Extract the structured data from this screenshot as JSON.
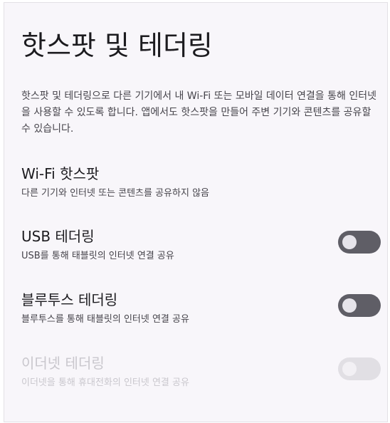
{
  "page": {
    "title": "핫스팟 및 테더링",
    "description": "핫스팟 및 테더링으로 다른 기기에서 내 Wi-Fi 또는 모바일 데이터 연결을 통해 인터넷을 사용할 수 있도록 합니다. 앱에서도 핫스팟을 만들어 주변 기기와 콘텐츠를 공유할 수 있습니다."
  },
  "items": [
    {
      "title": "Wi-Fi 핫스팟",
      "subtitle": "다른 기기와 인터넷 또는 콘텐츠를 공유하지 않음",
      "has_toggle": false
    },
    {
      "title": "USB 테더링",
      "subtitle": "USB를 통해 태블릿의 인터넷 연결 공유",
      "has_toggle": true,
      "toggle_on": false,
      "enabled": true
    },
    {
      "title": "블루투스 테더링",
      "subtitle": "블루투스를 통해 태블릿의 인터넷 연결 공유",
      "has_toggle": true,
      "toggle_on": false,
      "enabled": true
    },
    {
      "title": "이더넷 테더링",
      "subtitle": "이더넷을 통해 휴대전화의 인터넷 연결 공유",
      "has_toggle": true,
      "toggle_on": false,
      "enabled": false
    }
  ],
  "colors": {
    "background": "#f8f6fa",
    "text_primary": "#1c1b1f",
    "text_secondary": "#46444b",
    "text_disabled": "#c9c7cd",
    "toggle_track_off": "#5f5e66",
    "toggle_thumb_off": "#e6e4ea"
  }
}
